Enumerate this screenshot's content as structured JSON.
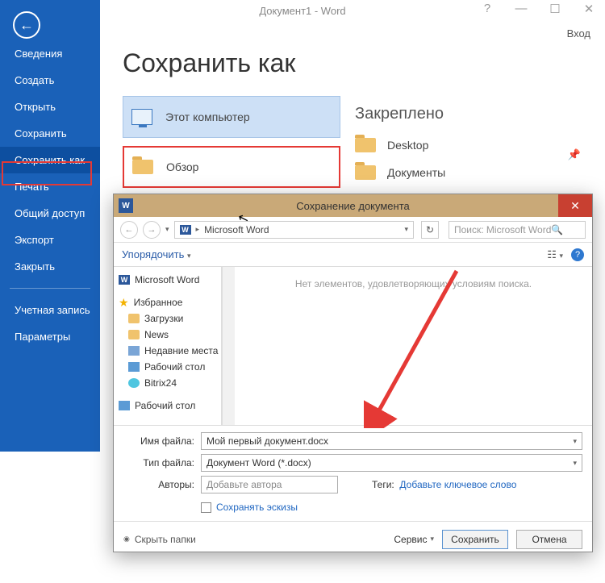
{
  "app_title": "Документ1 - Word",
  "login": "Вход",
  "sidebar": {
    "items": [
      "Сведения",
      "Создать",
      "Открыть",
      "Сохранить",
      "Сохранить как",
      "Печать",
      "Общий доступ",
      "Экспорт",
      "Закрыть"
    ],
    "account": "Учетная запись",
    "params": "Параметры",
    "active_index": 4
  },
  "main": {
    "heading": "Сохранить как",
    "computer": "Этот компьютер",
    "browse": "Обзор"
  },
  "pinned": {
    "heading": "Закреплено",
    "items": [
      "Desktop",
      "Документы"
    ]
  },
  "dialog": {
    "title": "Сохранение документа",
    "breadcrumb": "Microsoft Word",
    "search_placeholder": "Поиск: Microsoft Word",
    "organize": "Упорядочить",
    "empty": "Нет элементов, удовлетворяющих условиям поиска.",
    "tree": {
      "word": "Microsoft Word",
      "fav": "Избранное",
      "downloads": "Загрузки",
      "news": "News",
      "recent": "Недавние места",
      "desktop": "Рабочий стол",
      "bitrix": "Bitrix24",
      "desktop2": "Рабочий стол"
    },
    "form": {
      "filename_label": "Имя файла:",
      "filename": "Мой первый документ.docx",
      "type_label": "Тип файла:",
      "type": "Документ Word (*.docx)",
      "authors_label": "Авторы:",
      "authors": "Добавьте автора",
      "tags_label": "Теги:",
      "tags_link": "Добавьте ключевое слово",
      "thumbs": "Сохранять эскизы"
    },
    "footer": {
      "hide": "Скрыть папки",
      "service": "Сервис",
      "save": "Сохранить",
      "cancel": "Отмена"
    }
  }
}
